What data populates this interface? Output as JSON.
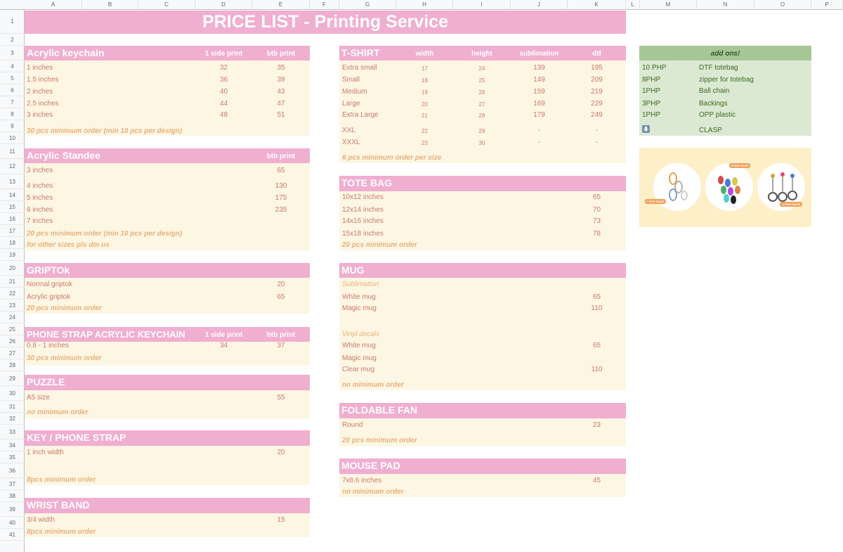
{
  "columns": [
    "A",
    "B",
    "C",
    "D",
    "E",
    "F",
    "G",
    "H",
    "I",
    "J",
    "K",
    "L",
    "M",
    "N",
    "O",
    "P"
  ],
  "rows": [
    "1",
    "2",
    "3",
    "4",
    "5",
    "6",
    "7",
    "8",
    "9",
    "10",
    "11",
    "12",
    "13",
    "14",
    "15",
    "16",
    "17",
    "18",
    "19",
    "20",
    "21",
    "22",
    "23",
    "24",
    "25",
    "26",
    "27",
    "28",
    "29",
    "30",
    "31",
    "32",
    "33",
    "34",
    "35",
    "36",
    "37",
    "38",
    "39",
    "40",
    "41"
  ],
  "title": "PRICE LIST - Printing Service",
  "keychain": {
    "title": "Acrylic keychain",
    "col1": "1 side print",
    "col2": "btb print",
    "items": [
      {
        "name": "1 inches",
        "side": "32",
        "btb": "35"
      },
      {
        "name": "1.5 inches",
        "side": "36",
        "btb": "39"
      },
      {
        "name": "2 inches",
        "side": "40",
        "btb": "43"
      },
      {
        "name": "2.5 inches",
        "side": "44",
        "btb": "47"
      },
      {
        "name": "3 inches",
        "side": "48",
        "btb": "51"
      }
    ],
    "note": "30 pcs minimum order (min 10 pcs per design)"
  },
  "standee": {
    "title": "Acrylic Standee",
    "col": "btb print",
    "items": [
      {
        "name": "3 inches",
        "btb": "65"
      },
      {
        "name": "4 inches",
        "btb": "130"
      },
      {
        "name": "5 inches",
        "btb": "175"
      },
      {
        "name": "6 inches",
        "btb": "235"
      },
      {
        "name": "7 inches",
        "btb": ""
      }
    ],
    "note1": "20 pcs minimum order (min 10 pcs per design)",
    "note2": "for other sizes pls dm us"
  },
  "griptok": {
    "title": "GRIPTOk",
    "items": [
      {
        "name": "Normal griptok",
        "price": "20"
      },
      {
        "name": "Acrylic griptok",
        "price": "65"
      }
    ],
    "note": "20 pcs minimum order"
  },
  "phonestrap": {
    "title": "PHONE STRAP ACRYLIC KEYCHAIN",
    "col1": "1 side print",
    "col2": "btb print",
    "item": {
      "name": "0.8 - 1 inches",
      "side": "34",
      "btb": "37"
    },
    "note": "30 pcs minimum order"
  },
  "puzzle": {
    "title": "PUZZLE",
    "item": {
      "name": "A5 size",
      "price": "55"
    },
    "note": "no minimum order"
  },
  "keystrap": {
    "title": "KEY / PHONE STRAP",
    "item": {
      "name": "1 inch width",
      "price": "20"
    },
    "note": "8pcs minimum order"
  },
  "wristband": {
    "title": "WRIST BAND",
    "item": {
      "name": "3/4 width",
      "price": "15"
    },
    "note": "8pcs minimum order"
  },
  "tshirt": {
    "title": "T-SHIRT",
    "cols": [
      "width",
      "height",
      "sublimation",
      "dtf"
    ],
    "items": [
      {
        "name": "Extra small",
        "w": "17",
        "h": "24",
        "sub": "139",
        "dtf": "195"
      },
      {
        "name": "Small",
        "w": "18",
        "h": "25",
        "sub": "149",
        "dtf": "209"
      },
      {
        "name": "Medium",
        "w": "19",
        "h": "26",
        "sub": "159",
        "dtf": "219"
      },
      {
        "name": "Large",
        "w": "20",
        "h": "27",
        "sub": "169",
        "dtf": "229"
      },
      {
        "name": "Extra Large",
        "w": "21",
        "h": "28",
        "sub": "179",
        "dtf": "249"
      },
      {
        "name": "XXL",
        "w": "22",
        "h": "29",
        "sub": "-",
        "dtf": "-"
      },
      {
        "name": "XXXL",
        "w": "23",
        "h": "30",
        "sub": "-",
        "dtf": "-"
      }
    ],
    "note": "6 pcs minimum order per size"
  },
  "totebag": {
    "title": "TOTE BAG",
    "items": [
      {
        "name": "10x12 inches",
        "price": "65"
      },
      {
        "name": "12x14 inches",
        "price": "70"
      },
      {
        "name": "14x16 inches",
        "price": "73"
      },
      {
        "name": "15x18 inches",
        "price": "78"
      }
    ],
    "note": "20 pcs minimum order"
  },
  "mug": {
    "title": "MUG",
    "sub1": "Sublimation",
    "items1": [
      {
        "name": "White mug",
        "price": "65"
      },
      {
        "name": "Magic mug",
        "price": "110"
      }
    ],
    "sub2": "Vinyl decals",
    "items2": [
      {
        "name": "White mug",
        "price": "65"
      },
      {
        "name": "Magic mug",
        "price": ""
      },
      {
        "name": "Clear mug",
        "price": "110"
      }
    ],
    "note": "no minimum order"
  },
  "fan": {
    "title": "FOLDABLE FAN",
    "item": {
      "name": "Round",
      "price": "23"
    },
    "note": "20 pcs minimum order"
  },
  "mousepad": {
    "title": "MOUSE PAD",
    "item": {
      "name": "7x8.6 inches",
      "price": "45"
    },
    "note": "no minimum order"
  },
  "addons": {
    "title": "add ons!",
    "items": [
      {
        "price": "10 PHP",
        "name": "DTF totebag"
      },
      {
        "price": "8PHP",
        "name": "zipper for totebag"
      },
      {
        "price": "1PHP",
        "name": "Ball chain"
      },
      {
        "price": "3PHP",
        "name": "Backings"
      },
      {
        "price": "1PHP",
        "name": "OPP plastic"
      },
      {
        "price": "",
        "name": "CLASP"
      }
    ],
    "icon": "down-arrow-icon"
  },
  "clasp_images": {
    "tags": [
      "7 PHP EACH",
      "8 PHP EACH",
      "10 PHP EACH"
    ]
  }
}
